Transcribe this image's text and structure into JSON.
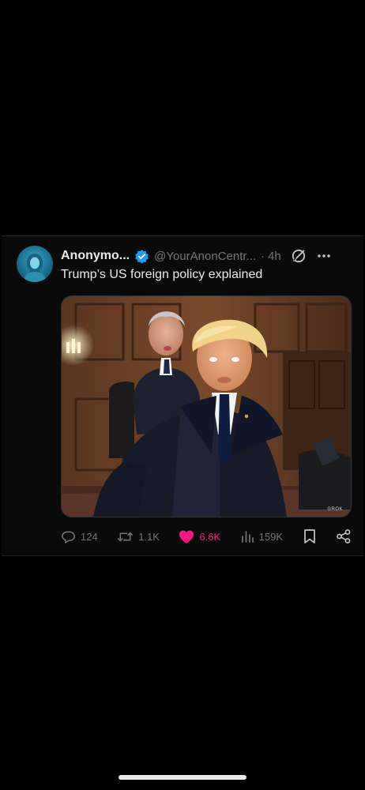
{
  "tweet": {
    "display_name": "Anonymo...",
    "handle": "@YourAnonCentr...",
    "separator": "·",
    "time": "4h",
    "text": "Trump’s US foreign policy explained",
    "media": {
      "watermark": "GROK",
      "icon_names": [
        "ai-generated-image"
      ]
    }
  },
  "actions": {
    "replies": "124",
    "reposts": "1.1K",
    "likes": "6.6K",
    "views": "159K"
  },
  "icons": {
    "avatar": "anonymous-avatar-icon",
    "verified": "verified-badge-icon",
    "grok": "grok-icon",
    "more": "more-icon",
    "reply": "reply-icon",
    "repost": "repost-icon",
    "like": "heart-icon",
    "views": "views-icon",
    "bookmark": "bookmark-icon",
    "share": "share-icon"
  },
  "colors": {
    "background": "#000000",
    "card": "#0a0a0a",
    "text": "#e7e9ea",
    "muted": "#71767b",
    "accent_blue": "#1d9bf0",
    "like_pink": "#f91880"
  }
}
